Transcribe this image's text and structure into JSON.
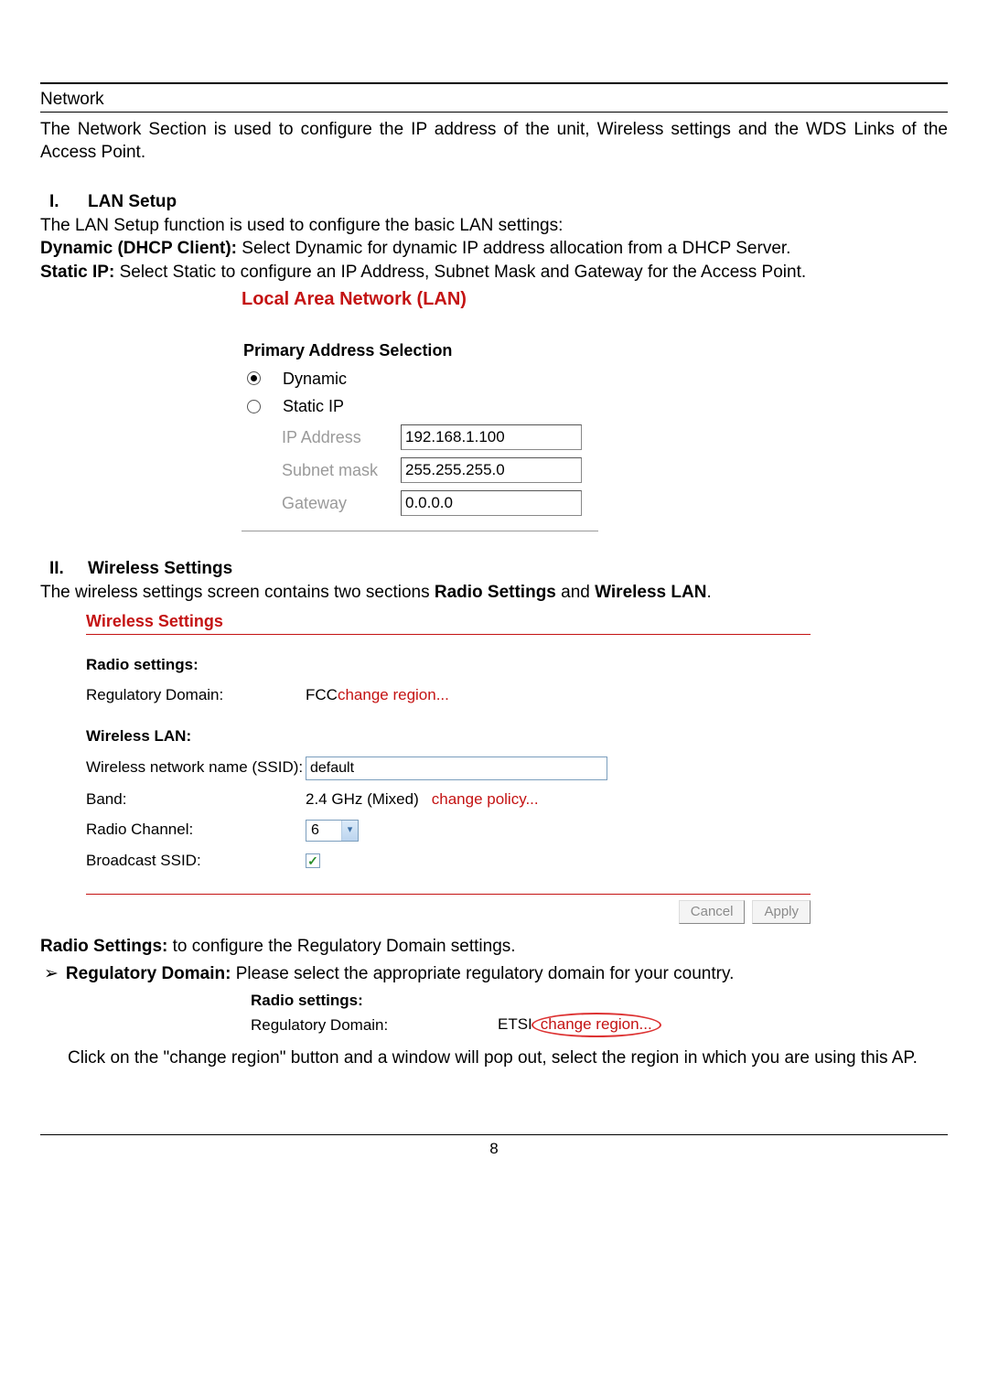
{
  "header": {
    "section_title": "Network",
    "body": "The Network Section is used to configure the IP address of the unit, Wireless settings and the WDS Links of the Access Point."
  },
  "lan_setup": {
    "num": "I.",
    "title": "LAN Setup",
    "intro": "The LAN Setup function is used to configure the basic LAN settings:",
    "dhcp_label": "Dynamic (DHCP Client): ",
    "dhcp_text": "Select Dynamic for dynamic IP address allocation from a DHCP Server.",
    "static_label": "Static IP: ",
    "static_text": "Select Static to configure an IP Address, Subnet Mask and Gateway for the Access Point.",
    "panel_title": "Local Area Network (LAN)",
    "panel_sub": "Primary Address Selection",
    "options": {
      "dynamic": "Dynamic",
      "static": "Static IP"
    },
    "fields": {
      "ip_label": "IP Address",
      "ip_value": "192.168.1.100",
      "mask_label": "Subnet mask",
      "mask_value": "255.255.255.0",
      "gw_label": "Gateway",
      "gw_value": "0.0.0.0"
    }
  },
  "wireless": {
    "num": "II.",
    "title": "Wireless Settings",
    "intro_a": "The wireless settings screen contains two sections ",
    "intro_b": "Radio Settings",
    "intro_c": " and ",
    "intro_d": "Wireless LAN",
    "intro_e": ".",
    "panel_title": "Wireless Settings",
    "radio_head": "Radio settings:",
    "reg_label": "Regulatory Domain:",
    "reg_value": "FCC ",
    "reg_link": "change region...",
    "wlan_head": "Wireless LAN:",
    "ssid_label": "Wireless network name (SSID):",
    "ssid_value": "default",
    "band_label": "Band:",
    "band_value": "2.4 GHz (Mixed)",
    "band_link": "change policy...",
    "channel_label": "Radio Channel:",
    "channel_value": "6",
    "broadcast_label": "Broadcast SSID:",
    "cancel": "Cancel",
    "apply": "Apply"
  },
  "radio_settings_text": {
    "lead_bold": "Radio Settings: ",
    "lead_rest": "to configure the Regulatory Domain settings.",
    "reg_bold": "Regulatory Domain: ",
    "reg_rest": "Please select the appropriate regulatory domain for your country.",
    "bullet": "➢"
  },
  "radio2_panel": {
    "head": "Radio settings:",
    "label": "Regulatory Domain:",
    "val_prefix": "ETSI",
    "link": "change region..."
  },
  "after_text": "Click on the \"change region\" button and a window will pop out, select the region in which you are using this AP.",
  "page_number": "8"
}
